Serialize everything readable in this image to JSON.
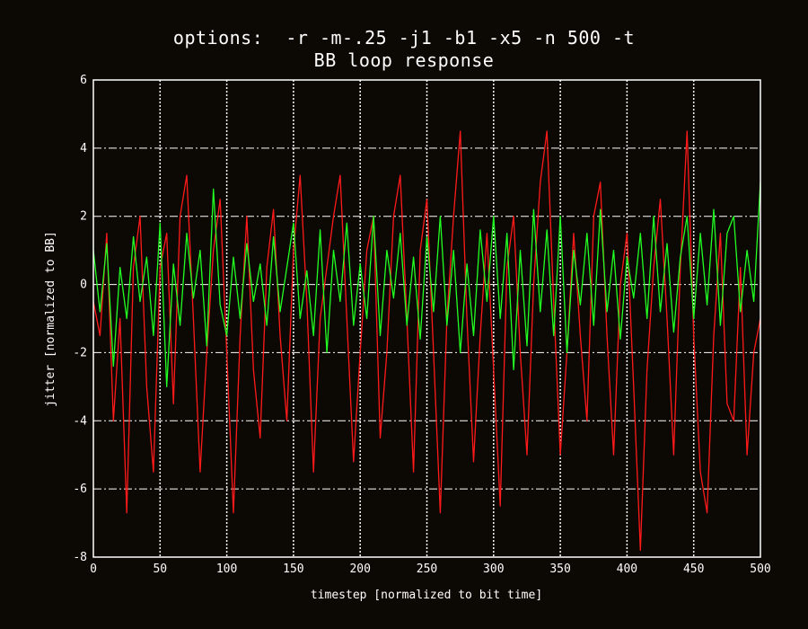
{
  "chart_data": {
    "type": "line",
    "title": "options:  -r -m-.25 -j1 -b1 -x5 -n 500 -t",
    "subtitle": "BB loop response",
    "xlabel": "timestep [normalized to bit time]",
    "ylabel": "jitter [normalized to BB]",
    "xlim": [
      0,
      500
    ],
    "ylim": [
      -8,
      6
    ],
    "xticks": [
      0,
      50,
      100,
      150,
      200,
      250,
      300,
      350,
      400,
      450,
      500
    ],
    "yticks": [
      -8,
      -6,
      -4,
      -2,
      0,
      2,
      4,
      6
    ],
    "grid": true,
    "legend": "none",
    "colors": {
      "background": "#0c0804",
      "frame": "#ffffff",
      "series_red": "#ff1a1a",
      "series_green": "#22ff22"
    },
    "series": [
      {
        "color": "#ff1a1a",
        "x": [
          0,
          5,
          10,
          15,
          20,
          25,
          30,
          35,
          40,
          45,
          50,
          55,
          60,
          65,
          70,
          75,
          80,
          85,
          90,
          95,
          100,
          105,
          110,
          115,
          120,
          125,
          130,
          135,
          140,
          145,
          150,
          155,
          160,
          165,
          170,
          175,
          180,
          185,
          190,
          195,
          200,
          205,
          210,
          215,
          220,
          225,
          230,
          235,
          240,
          245,
          250,
          255,
          260,
          265,
          270,
          275,
          280,
          285,
          290,
          295,
          300,
          305,
          310,
          315,
          320,
          325,
          330,
          335,
          340,
          345,
          350,
          355,
          360,
          365,
          370,
          375,
          380,
          385,
          390,
          395,
          400,
          405,
          410,
          415,
          420,
          425,
          430,
          435,
          440,
          445,
          450,
          455,
          460,
          465,
          470,
          475,
          480,
          485,
          490,
          495,
          500
        ],
        "y": [
          -0.5,
          -1.5,
          1.5,
          -4.0,
          -1.0,
          -6.7,
          0.5,
          2.0,
          -3.0,
          -5.5,
          0.5,
          1.5,
          -3.5,
          2.0,
          3.2,
          -1.0,
          -5.5,
          -2.0,
          1.0,
          2.5,
          -2.0,
          -6.7,
          -1.5,
          2.0,
          -2.5,
          -4.5,
          0.5,
          2.2,
          -1.5,
          -4.0,
          1.0,
          3.2,
          -0.5,
          -5.5,
          -1.0,
          0.5,
          2.0,
          3.2,
          -1.0,
          -5.2,
          -2.0,
          1.0,
          2.0,
          -4.5,
          -2.0,
          2.0,
          3.2,
          -1.0,
          -5.5,
          1.0,
          2.5,
          -2.0,
          -6.7,
          -1.0,
          2.0,
          4.5,
          -1.0,
          -5.2,
          -1.5,
          1.5,
          -2.5,
          -6.5,
          0.5,
          2.0,
          -2.0,
          -5.0,
          0.0,
          3.0,
          4.5,
          -0.5,
          -5.0,
          -2.0,
          1.5,
          -1.5,
          -4.0,
          2.0,
          3.0,
          -1.5,
          -5.0,
          0.0,
          1.5,
          -3.0,
          -7.8,
          -2.5,
          0.5,
          2.5,
          -1.0,
          -5.0,
          0.5,
          4.5,
          -1.5,
          -5.5,
          -6.7,
          -1.5,
          1.5,
          -3.5,
          -4.0,
          0.5,
          -5.0,
          -2.0,
          -1.0
        ]
      },
      {
        "color": "#22ff22",
        "x": [
          0,
          5,
          10,
          15,
          20,
          25,
          30,
          35,
          40,
          45,
          50,
          55,
          60,
          65,
          70,
          75,
          80,
          85,
          90,
          95,
          100,
          105,
          110,
          115,
          120,
          125,
          130,
          135,
          140,
          145,
          150,
          155,
          160,
          165,
          170,
          175,
          180,
          185,
          190,
          195,
          200,
          205,
          210,
          215,
          220,
          225,
          230,
          235,
          240,
          245,
          250,
          255,
          260,
          265,
          270,
          275,
          280,
          285,
          290,
          295,
          300,
          305,
          310,
          315,
          320,
          325,
          330,
          335,
          340,
          345,
          350,
          355,
          360,
          365,
          370,
          375,
          380,
          385,
          390,
          395,
          400,
          405,
          410,
          415,
          420,
          425,
          430,
          435,
          440,
          445,
          450,
          455,
          460,
          465,
          470,
          475,
          480,
          485,
          490,
          495,
          500
        ],
        "y": [
          1.0,
          -0.8,
          1.2,
          -2.4,
          0.5,
          -1.0,
          1.4,
          -0.5,
          0.8,
          -1.5,
          1.8,
          -3.0,
          0.6,
          -1.2,
          1.5,
          -0.4,
          1.0,
          -1.8,
          2.8,
          -0.6,
          -1.5,
          0.8,
          -1.0,
          1.2,
          -0.5,
          0.6,
          -1.2,
          1.4,
          -0.8,
          0.5,
          1.8,
          -1.0,
          0.4,
          -1.5,
          1.6,
          -2.0,
          1.0,
          -0.5,
          1.8,
          -1.2,
          0.6,
          -1.0,
          2.0,
          -1.5,
          1.0,
          -0.4,
          1.5,
          -1.2,
          0.8,
          -1.6,
          1.4,
          -0.8,
          2.0,
          -1.2,
          1.0,
          -2.0,
          0.6,
          -1.5,
          1.6,
          -0.5,
          2.0,
          -1.0,
          1.5,
          -2.5,
          1.0,
          -1.8,
          2.2,
          -0.8,
          1.6,
          -1.5,
          2.0,
          -2.0,
          1.0,
          -0.6,
          1.5,
          -1.2,
          2.2,
          -0.8,
          1.0,
          -1.6,
          0.8,
          -0.4,
          1.5,
          -1.0,
          2.0,
          -0.8,
          1.2,
          -1.4,
          0.8,
          2.0,
          -1.0,
          1.5,
          -0.6,
          2.2,
          -1.2,
          1.5,
          2.0,
          -0.8,
          1.0,
          -0.5,
          3.0
        ]
      }
    ]
  }
}
